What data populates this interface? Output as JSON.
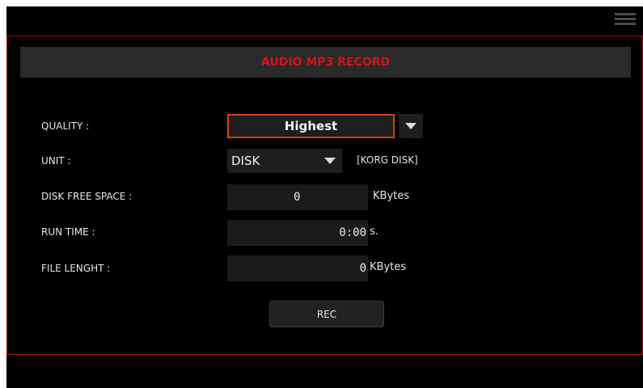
{
  "title": "AUDIO MP3 RECORD",
  "quality": {
    "label": "QUALITY :",
    "value": "Highest"
  },
  "unit": {
    "label": "UNIT :",
    "value": "DISK",
    "device": "[KORG DISK]"
  },
  "disk_free_space": {
    "label": "DISK FREE SPACE :",
    "value": "0",
    "unit": "KBytes"
  },
  "run_time": {
    "label": "RUN TIME :",
    "value": "0:00",
    "unit": "s."
  },
  "file_length": {
    "label": "FILE LENGHT :",
    "value": "0",
    "unit": "KBytes"
  },
  "rec_label": "REC",
  "icons": {
    "menu": "menu-icon",
    "dropdown": "chevron-down-icon"
  },
  "colors": {
    "accent": "#d0131a",
    "highlight_border": "#d0401a",
    "background": "#000000"
  }
}
